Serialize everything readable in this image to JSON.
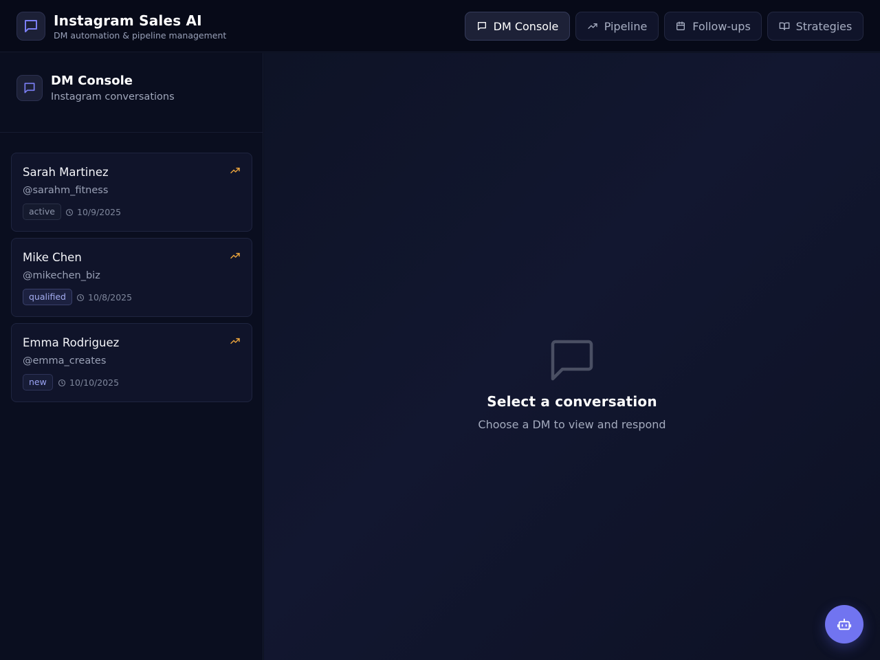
{
  "app": {
    "title": "Instagram Sales AI",
    "subtitle": "DM automation & pipeline management",
    "logo_icon": "message-square-icon"
  },
  "nav": [
    {
      "label": "DM Console",
      "icon": "message-square-icon",
      "active": true
    },
    {
      "label": "Pipeline",
      "icon": "trending-up-icon",
      "active": false
    },
    {
      "label": "Follow-ups",
      "icon": "calendar-icon",
      "active": false
    },
    {
      "label": "Strategies",
      "icon": "book-open-icon",
      "active": false
    }
  ],
  "sidebar": {
    "title": "DM Console",
    "subtitle": "Instagram conversations",
    "icon": "message-square-icon",
    "conversations": [
      {
        "name": "Sarah Martinez",
        "handle": "@sarahm_fitness",
        "status": "active",
        "date": "10/9/2025"
      },
      {
        "name": "Mike Chen",
        "handle": "@mikechen_biz",
        "status": "qualified",
        "date": "10/8/2025"
      },
      {
        "name": "Emma Rodriguez",
        "handle": "@emma_creates",
        "status": "new",
        "date": "10/10/2025"
      }
    ]
  },
  "empty_state": {
    "title": "Select a conversation",
    "subtitle": "Choose a DM to view and respond",
    "icon": "message-square-icon"
  },
  "fab": {
    "icon": "bot-icon"
  },
  "colors": {
    "accent": "#7174f0",
    "trend": "#e8a23c",
    "background": "#0b0f1e"
  }
}
